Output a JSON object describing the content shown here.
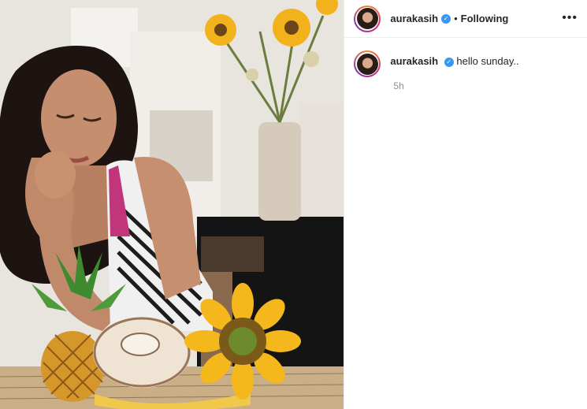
{
  "post": {
    "header": {
      "username": "aurakasih",
      "separator": "•",
      "follow_status": "Following",
      "more_icon": "more-horizontal-icon"
    },
    "caption": {
      "username": "aurakasih",
      "text": "hello sunday..",
      "timestamp": "5h"
    }
  },
  "colors": {
    "verified": "#3897f0",
    "text": "#262626",
    "muted": "#8e8e8e"
  }
}
